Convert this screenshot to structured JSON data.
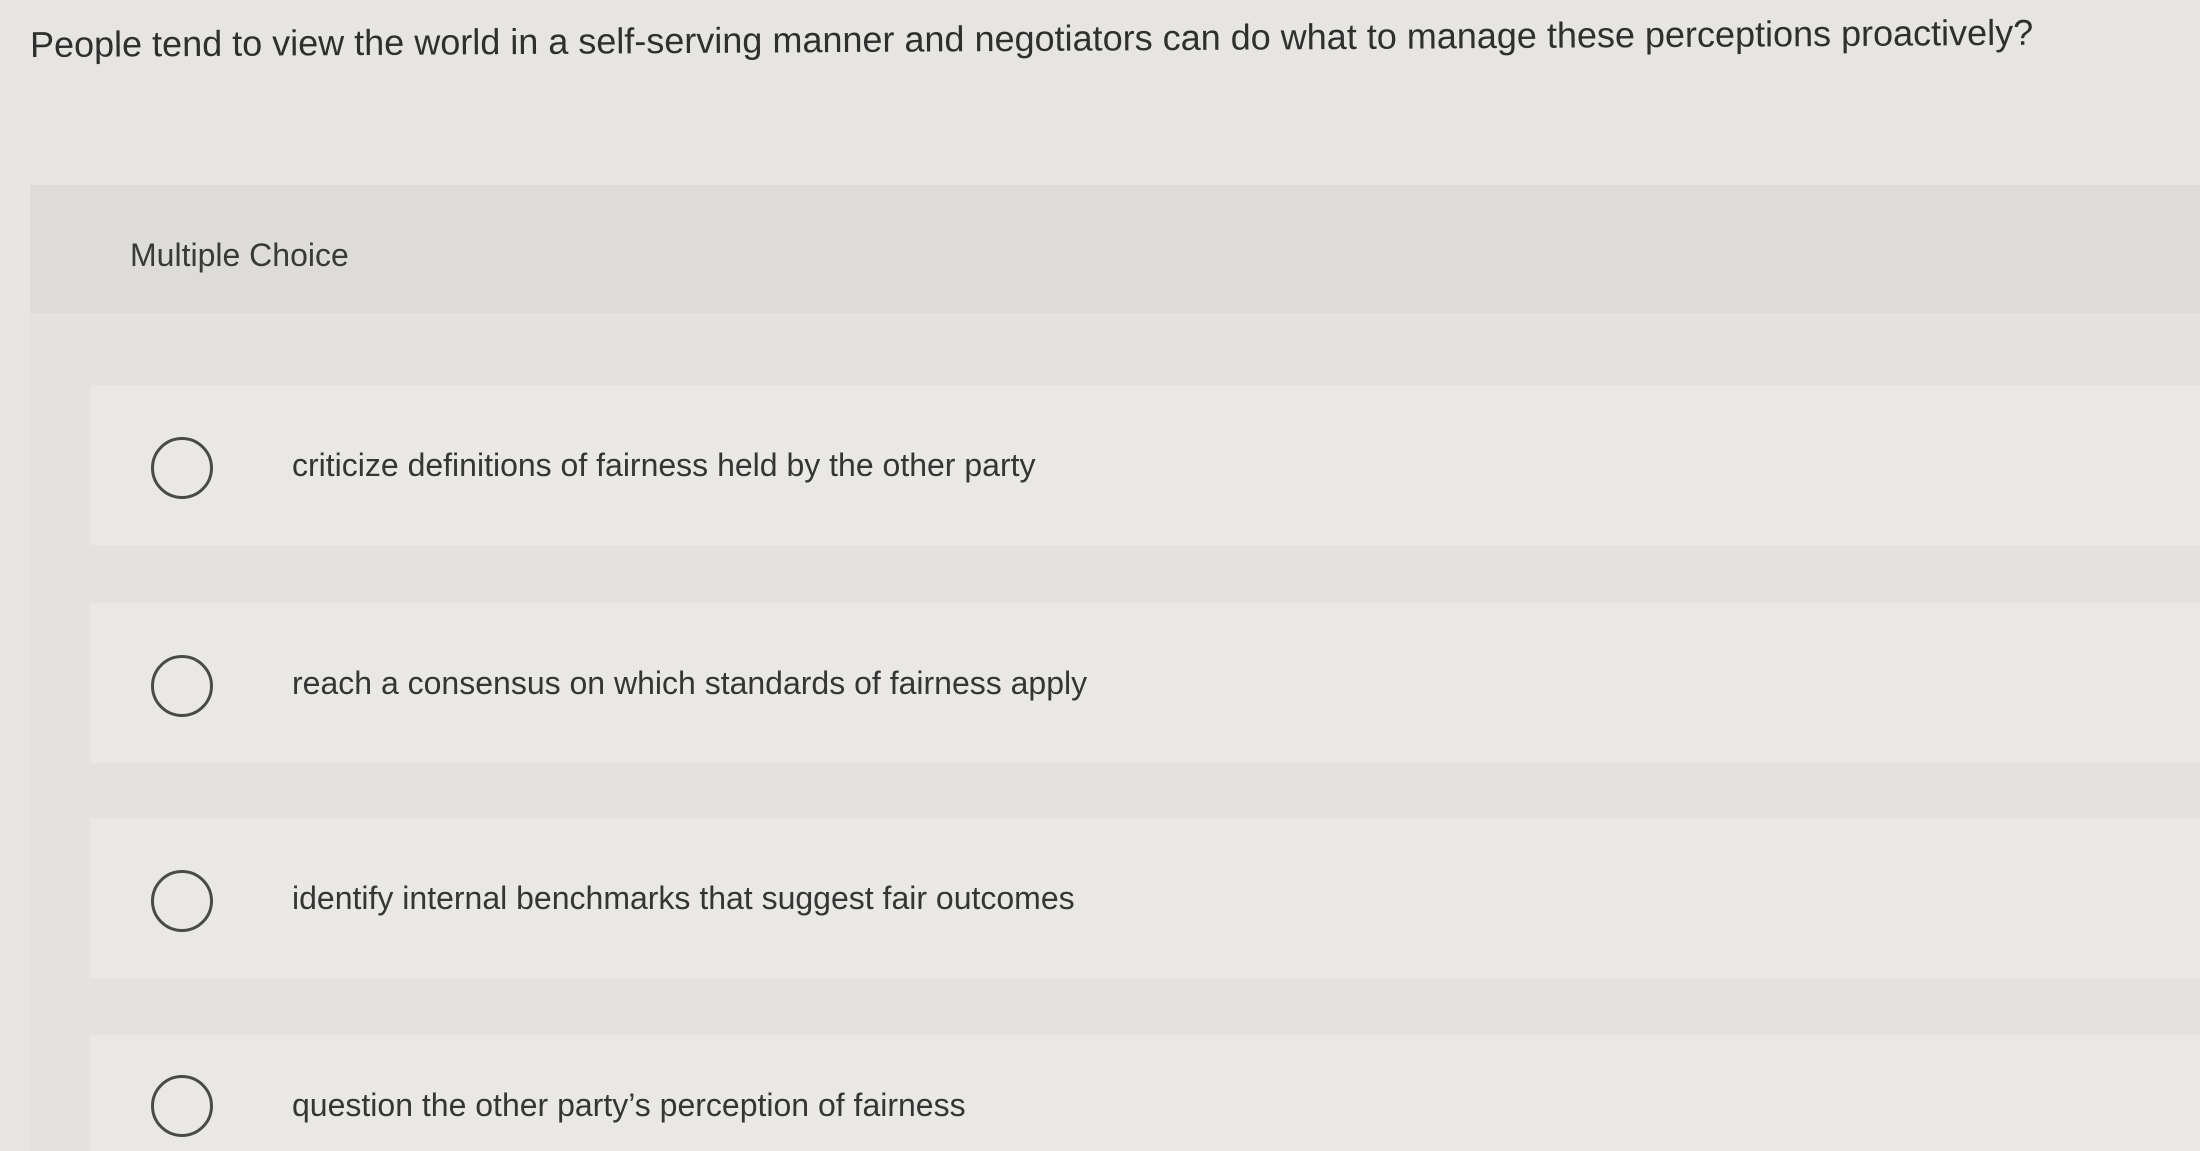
{
  "question": {
    "text": "People tend to view the world in a self-serving manner and negotiators can do what to manage these perceptions proactively?"
  },
  "panel": {
    "type_label": "Multiple Choice"
  },
  "options": [
    {
      "label": "criticize definitions of fairness held by the other party",
      "selected": false
    },
    {
      "label": "reach a consensus on which standards of fairness apply",
      "selected": false
    },
    {
      "label": "identify internal benchmarks that suggest fair outcomes",
      "selected": false
    },
    {
      "label": "question the other party’s perception of fairness",
      "selected": false
    }
  ]
}
